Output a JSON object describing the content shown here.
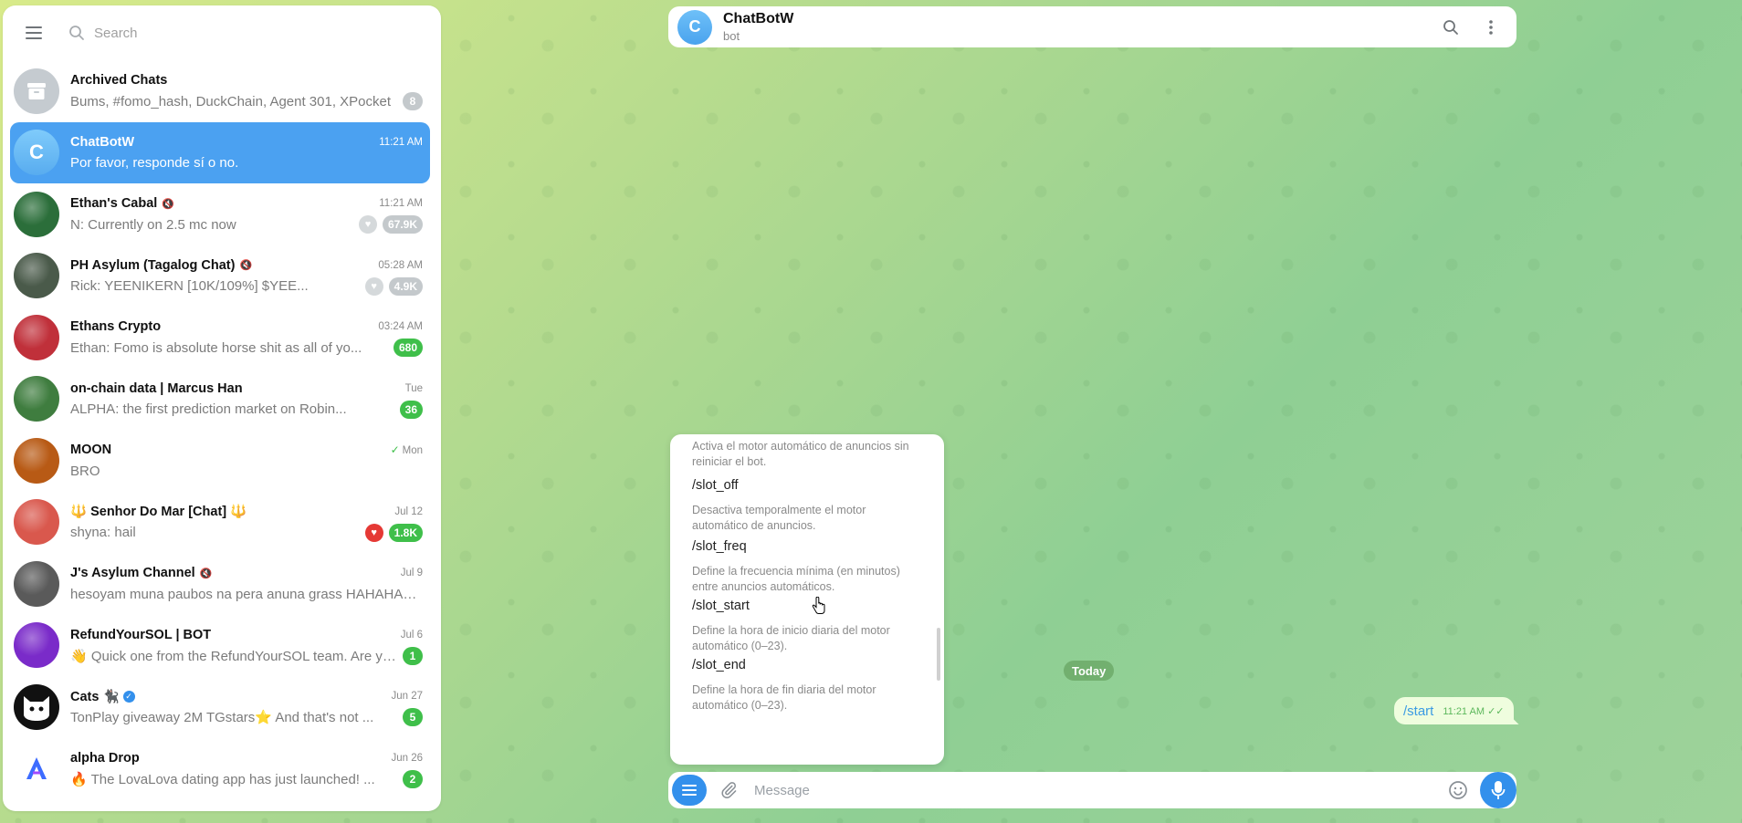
{
  "search": {
    "placeholder": "Search"
  },
  "chats": [
    {
      "id": "archived",
      "title": "Archived Chats",
      "preview": "Bums, #fomo_hash, DuckChain, Agent 301, XPocket",
      "time": "",
      "badge": "8",
      "badge_muted": true,
      "avatar_color": "#c5cbd0"
    },
    {
      "id": "chatbotw",
      "title": "ChatBotW",
      "preview": "Por favor, responde sí o no.",
      "time": "11:21 AM",
      "active": true,
      "avatar_letter": "C",
      "avatar_color": "#6ec0f8"
    },
    {
      "id": "ethans-cabal",
      "title": "Ethan's Cabal",
      "preview": "N: Currently on 2.5 mc now",
      "time": "11:21 AM",
      "muted": true,
      "badge": "67.9K",
      "badge_muted": true,
      "heart_muted": true,
      "avatar_color": "#2b6e3a"
    },
    {
      "id": "ph-asylum",
      "title": "PH Asylum (Tagalog Chat)",
      "preview": "Rick: YEENIKERN [10K/109%] $YEE...",
      "time": "05:28 AM",
      "muted": true,
      "badge": "4.9K",
      "badge_muted": true,
      "heart_muted": true,
      "avatar_color": "#4a5a4a"
    },
    {
      "id": "ethans-crypto",
      "title": "Ethans Crypto",
      "sender": "Ethan:",
      "preview": "Fomo is absolute horse shit as all of yo...",
      "time": "03:24 AM",
      "badge": "680",
      "avatar_color": "#c0303a"
    },
    {
      "id": "on-chain-data",
      "title": "on-chain data | Marcus Han",
      "preview": "ALPHA: the first prediction market on Robin...",
      "time": "Tue",
      "badge": "36",
      "avatar_color": "#3f7d3f"
    },
    {
      "id": "moon",
      "title": "MOON",
      "preview": "BRO",
      "time": "Mon",
      "read_check": true,
      "avatar_color": "#b85a15"
    },
    {
      "id": "senhor-do-mar",
      "title": "🔱 Senhor Do Mar [Chat] 🔱",
      "sender": "shyna:",
      "preview": "hail",
      "time": "Jul 12",
      "badge": "1.8K",
      "heart": true,
      "avatar_color": "#d9584d"
    },
    {
      "id": "js-asylum",
      "title": "J's Asylum Channel",
      "preview": "hesoyam muna paubos na pera anuna grass HAHAHAH...",
      "time": "Jul 9",
      "muted": true,
      "avatar_color": "#5a5a5a"
    },
    {
      "id": "refundyoursol",
      "title": "RefundYourSOL | BOT",
      "preview": "👋 Quick one from the RefundYourSOL team. Are yo...",
      "time": "Jul 6",
      "badge": "1",
      "avatar_color": "#7a2bc9"
    },
    {
      "id": "cats",
      "title": "Cats 🐈‍⬛",
      "verified": true,
      "preview": "TonPlay giveaway 2M TGstars⭐ And that's not ...",
      "time": "Jun 27",
      "badge": "5",
      "avatar_color": "#111111"
    },
    {
      "id": "alpha-drop",
      "title": "alpha Drop",
      "preview": "🔥 The LovaLova dating app has just launched! ...",
      "time": "Jun 26",
      "badge": "2",
      "avatar_color": "#ffffff"
    }
  ],
  "header": {
    "title": "ChatBotW",
    "subtitle": "bot",
    "avatar_letter": "C"
  },
  "commands": {
    "top_desc": "Activa el motor automático de anuncios sin reiniciar el bot.",
    "items": [
      {
        "name": "/slot_off",
        "desc": "Desactiva temporalmente el motor automático de anuncios."
      },
      {
        "name": "/slot_freq",
        "desc": "Define la frecuencia mínima (en minutos) entre anuncios automáticos."
      },
      {
        "name": "/slot_start",
        "desc": "Define la hora de inicio diaria del motor automático (0–23)."
      },
      {
        "name": "/slot_end",
        "desc": "Define la hora de fin diaria del motor automático (0–23)."
      }
    ]
  },
  "messages": {
    "date_label": "Today",
    "outgoing": {
      "text": "/start",
      "time": "11:21 AM"
    }
  },
  "composer": {
    "placeholder": "Message"
  },
  "colors": {
    "accent": "#3390ec",
    "active_chat": "#4ba1f1",
    "unread_badge": "#3fbf4a"
  }
}
